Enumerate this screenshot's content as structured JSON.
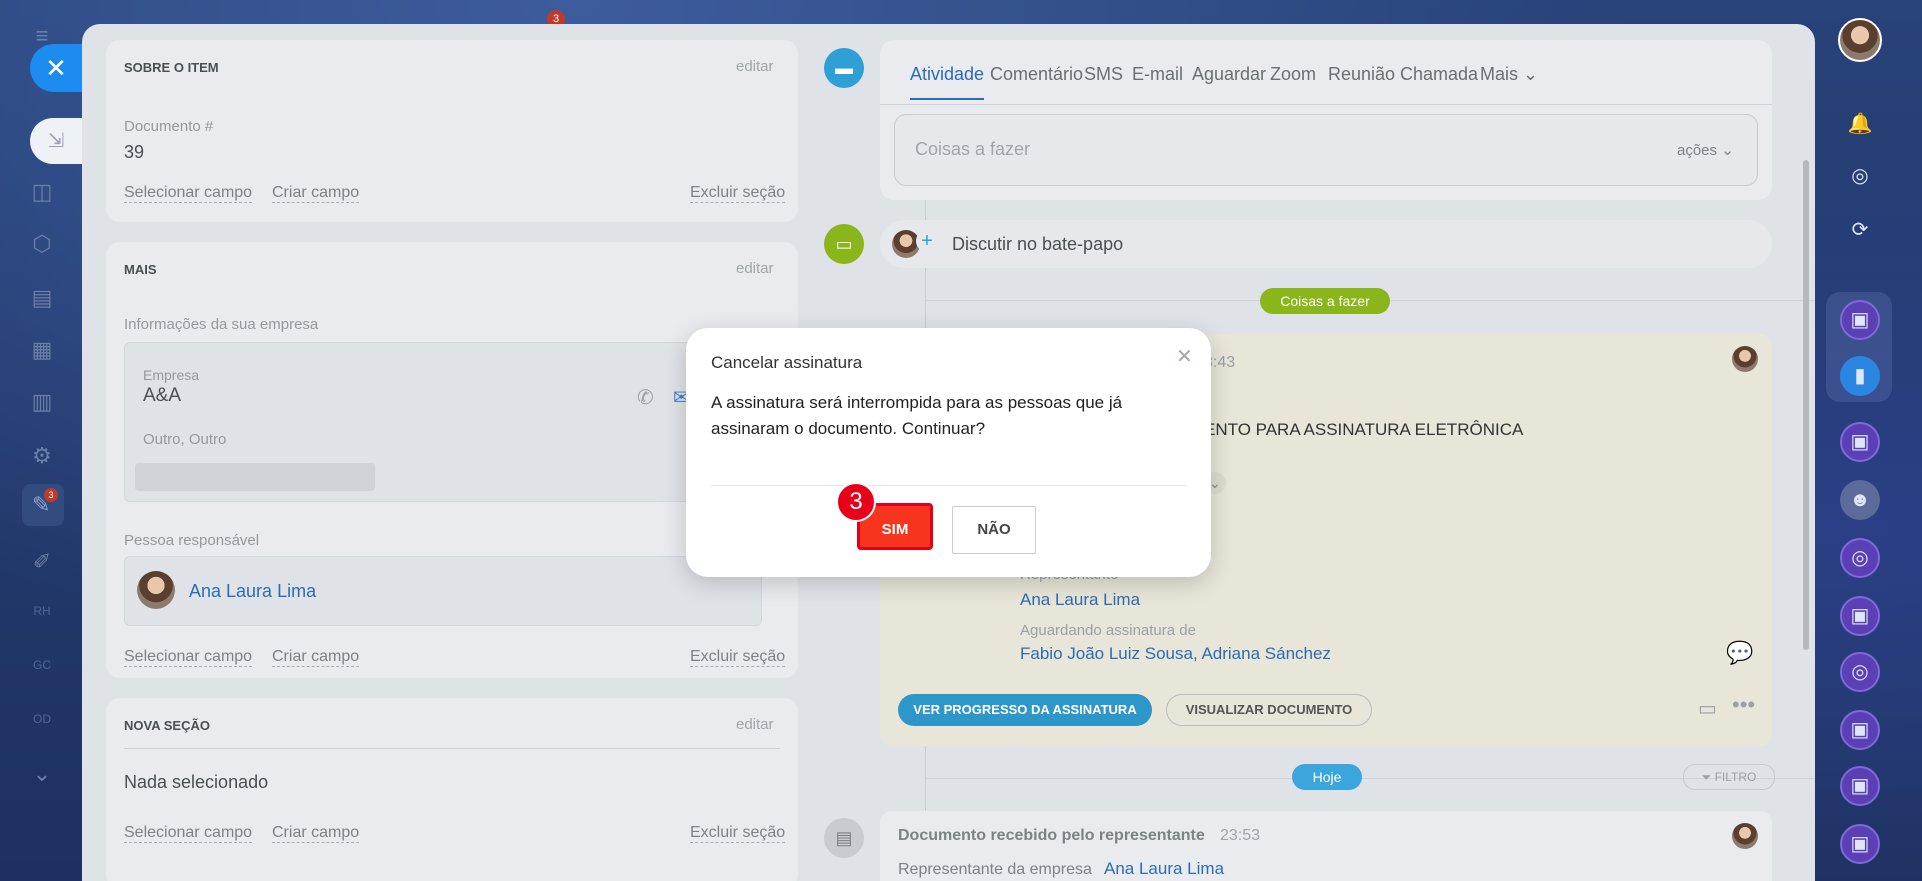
{
  "left_rail": {
    "notification_count": "3",
    "labels": [
      "RH",
      "GC",
      "OD"
    ],
    "nav_badge": "3"
  },
  "sections": {
    "about": {
      "title": "SOBRE O ITEM",
      "edit": "editar",
      "doc_label": "Documento #",
      "doc_value": "39",
      "select_field": "Selecionar campo",
      "create_field": "Criar campo",
      "delete_section": "Excluir seção"
    },
    "more": {
      "title": "MAIS",
      "edit": "editar",
      "company_info_label": "Informações da sua empresa",
      "company_label": "Empresa",
      "company_value": "A&A",
      "company_type": "Outro, Outro",
      "responsible_label": "Pessoa responsável",
      "responsible_name": "Ana Laura Lima",
      "select_field": "Selecionar campo",
      "create_field": "Criar campo",
      "delete_section": "Excluir seção"
    },
    "new_section": {
      "title": "NOVA SEÇÃO",
      "edit": "editar",
      "empty": "Nada selecionado",
      "select_field": "Selecionar campo",
      "create_field": "Criar campo",
      "delete_section": "Excluir seção"
    }
  },
  "timeline": {
    "tabs": [
      "Atividade",
      "Comentário",
      "SMS",
      "E-mail",
      "Aguardar",
      "Zoom",
      "Reunião",
      "Chamada",
      "Mais"
    ],
    "todo_placeholder": "Coisas a fazer",
    "actions": "ações",
    "chat": "Discutir no bate-papo",
    "todo_pill": "Coisas a fazer",
    "card": {
      "time": "3:43",
      "headline": "ENTO PARA ASSINATURA ELETRÔNICA",
      "rep_label": "Representante",
      "rep_name": "Ana Laura Lima",
      "waiting_label": "Aguardando assinatura de",
      "waiting_names": "Fabio João Luiz Sousa, Adriana Sánchez",
      "btn_progress": "VER PROGRESSO DA ASSINATURA",
      "btn_view": "VISUALIZAR DOCUMENTO"
    },
    "today_pill": "Hoje",
    "filter": "FILTRO",
    "received": {
      "title": "Documento recebido pelo representante",
      "time": "23:53",
      "rep_label": "Representante da empresa",
      "rep_name": "Ana Laura Lima"
    }
  },
  "modal": {
    "title": "Cancelar assinatura",
    "message": "A assinatura será interrompida para as pessoas que já assinaram o documento. Continuar?",
    "yes": "SIM",
    "no": "NÃO",
    "step": "3"
  },
  "colors": {
    "accent_blue": "#1c8cf0",
    "danger": "#f7351f",
    "link": "#2d6cb5",
    "pill_green": "#8ab51b",
    "pill_blue": "#3aa6dc"
  }
}
